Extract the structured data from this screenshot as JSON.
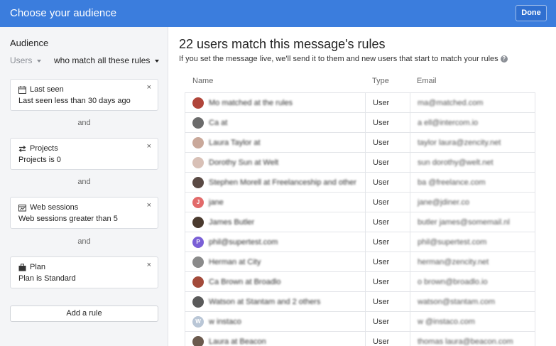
{
  "header": {
    "title": "Choose your audience",
    "done_label": "Done"
  },
  "sidebar": {
    "heading": "Audience",
    "users_selector": "Users",
    "match_selector": "who match all these rules",
    "rules": [
      {
        "title": "Last seen",
        "description": "Last seen less than 30 days ago",
        "icon": "calendar-icon"
      },
      {
        "title": "Projects",
        "description": "Projects is 0",
        "icon": "arrows-icon"
      },
      {
        "title": "Web sessions",
        "description": "Web sessions greater than 5",
        "icon": "browser-window-icon"
      },
      {
        "title": "Plan",
        "description": "Plan is Standard",
        "icon": "briefcase-icon"
      }
    ],
    "close_glyph": "×",
    "and_label": "and",
    "add_rule_label": "Add a rule"
  },
  "main": {
    "headline": "22 users match this message's rules",
    "subline": "If you set the message live, we'll send it to them and new users that start to match your rules",
    "help_glyph": "?",
    "columns": {
      "name": "Name",
      "type": "Type",
      "email": "Email"
    },
    "users": [
      {
        "avatar_color": "#b0453a",
        "avatar_letter": "",
        "name": "Mo matched at the rules",
        "type": "User",
        "email": "ma@matched.com"
      },
      {
        "avatar_color": "#6b6b6b",
        "avatar_letter": "",
        "name": "Ca at ",
        "type": "User",
        "email": "a ell@intercom.io"
      },
      {
        "avatar_color": "#c9a89a",
        "avatar_letter": "",
        "name": "Laura Taylor at ",
        "type": "User",
        "email": "taylor laura@zencity.net"
      },
      {
        "avatar_color": "#d8c0b6",
        "avatar_letter": "",
        "name": "Dorothy Sun at Welt",
        "type": "User",
        "email": "sun dorothy@welt.net"
      },
      {
        "avatar_color": "#5a4a44",
        "avatar_letter": "",
        "name": "Stephen Morell at Freelanceship and other",
        "type": "User",
        "email": "ba @freelance.com"
      },
      {
        "avatar_color": "#e26a6a",
        "avatar_letter": "J",
        "name": "jane ",
        "type": "User",
        "email": "jane@jdiner.co"
      },
      {
        "avatar_color": "#4a3a2e",
        "avatar_letter": "",
        "name": "James Butler",
        "type": "User",
        "email": "butler james@somemail.nl"
      },
      {
        "avatar_color": "#7a5fd6",
        "avatar_letter": "P",
        "name": "phil@supertest.com",
        "type": "User",
        "email": "phil@supertest.com"
      },
      {
        "avatar_color": "#8a8a8a",
        "avatar_letter": "",
        "name": "Herman at City",
        "type": "User",
        "email": "herman@zencity.net"
      },
      {
        "avatar_color": "#a34a3a",
        "avatar_letter": "",
        "name": "Ca Brown at Broadlo",
        "type": "User",
        "email": "o brown@broadlo.io"
      },
      {
        "avatar_color": "#5a5a5a",
        "avatar_letter": "",
        "name": "Watson at Stantam and 2 others",
        "type": "User",
        "email": "watson@stantam.com"
      },
      {
        "avatar_color": "#b9c6d6",
        "avatar_letter": "W",
        "name": "w instaco",
        "type": "User",
        "email": "w @instaco.com"
      },
      {
        "avatar_color": "#6b5a4e",
        "avatar_letter": "",
        "name": "Laura at Beacon",
        "type": "User",
        "email": "thomas laura@beacon.com"
      }
    ]
  }
}
